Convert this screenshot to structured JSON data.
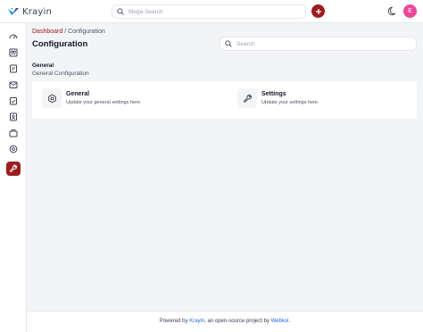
{
  "header": {
    "brand": "Krayin",
    "search_placeholder": "Mega Search",
    "avatar_letter": "E"
  },
  "sidebar": {
    "items": [
      {
        "icon": "dashboard-icon"
      },
      {
        "icon": "leads-icon"
      },
      {
        "icon": "quotes-icon"
      },
      {
        "icon": "mail-icon"
      },
      {
        "icon": "activities-icon"
      },
      {
        "icon": "contacts-icon"
      },
      {
        "icon": "products-icon"
      },
      {
        "icon": "settings-icon"
      },
      {
        "icon": "configuration-icon",
        "active": true
      }
    ]
  },
  "breadcrumb": {
    "link": "Dashboard",
    "separator": " / ",
    "current": "Configuration"
  },
  "page": {
    "title": "Configuration",
    "search_placeholder": "Search"
  },
  "section": {
    "title": "General",
    "subtitle": "General Configuration"
  },
  "config_items": [
    {
      "title": "General",
      "description": "Update your general settings here.",
      "icon": "gear-icon"
    },
    {
      "title": "Settings",
      "description": "Update your settings here.",
      "icon": "wrench-icon"
    }
  ],
  "footer": {
    "prefix": "Powered by ",
    "link1": "Krayin",
    "middle": ", an open-source project by ",
    "link2": "Webkul",
    "suffix": "."
  },
  "colors": {
    "brand": "#9b1c20",
    "avatar": "#ec4899",
    "link": "#2563eb"
  }
}
